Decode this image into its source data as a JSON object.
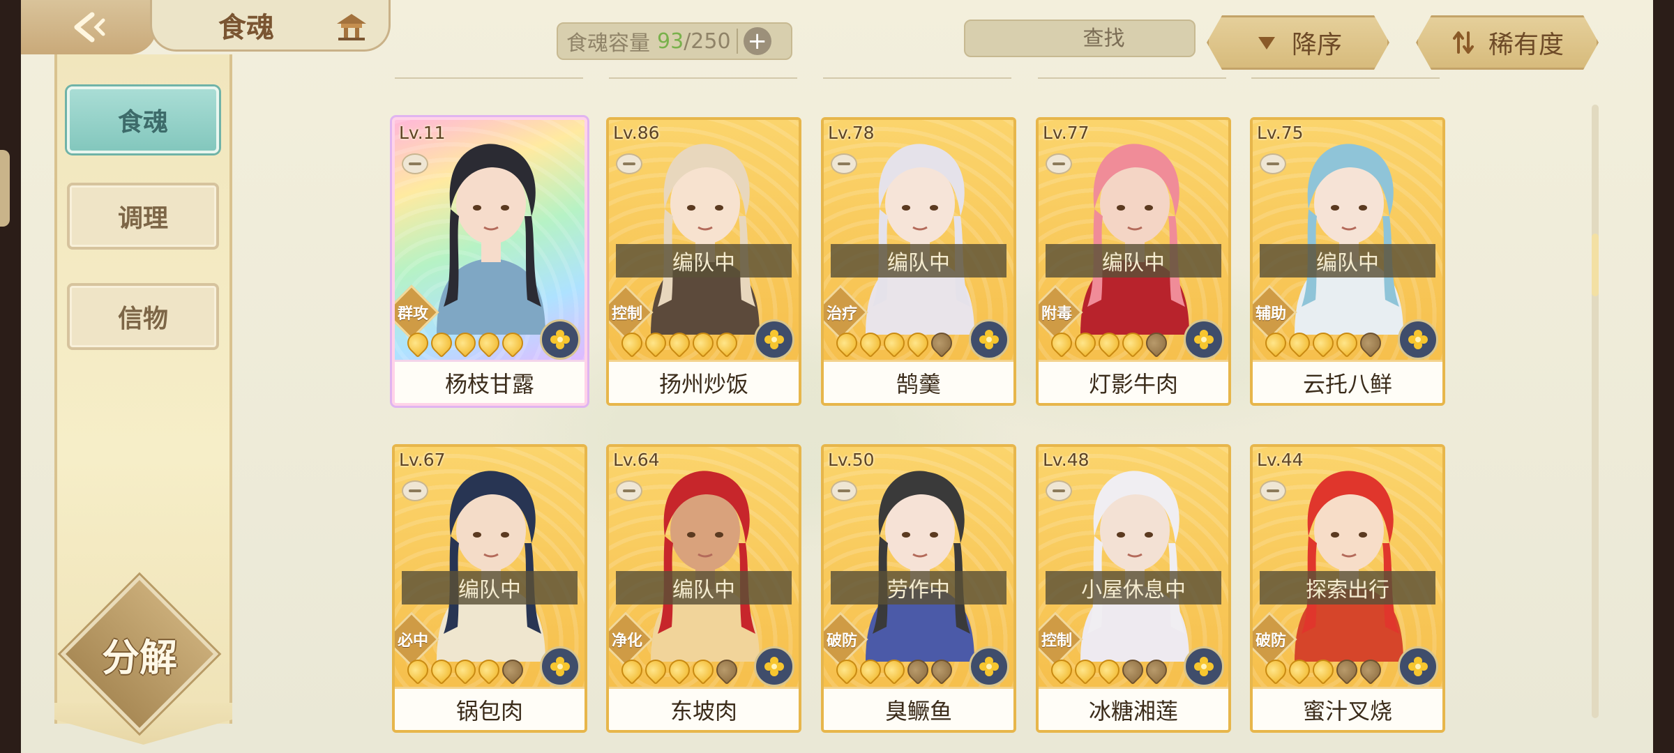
{
  "header": {
    "title": "食魂",
    "capacity_label": "食魂容量",
    "capacity_current": "93",
    "capacity_total": "/250",
    "search_placeholder": "查找",
    "sort_order_label": "降序",
    "sort_by_label": "稀有度"
  },
  "sidebar": {
    "items": [
      {
        "label": "食魂",
        "active": true
      },
      {
        "label": "调理",
        "active": false
      },
      {
        "label": "信物",
        "active": false
      }
    ],
    "decompose_label": "分解"
  },
  "cards": [
    {
      "level": "Lv.11",
      "name": "杨枝甘露",
      "status": "",
      "role": "群攻",
      "stars_filled": 5,
      "rarity": "rainbow",
      "hair": "#2b2b33",
      "skin": "#f6dccb",
      "outfit": "#7fa7c4"
    },
    {
      "level": "Lv.86",
      "name": "扬州炒饭",
      "status": "编队中",
      "role": "控制",
      "stars_filled": 5,
      "rarity": "gold",
      "hair": "#e8d7bd",
      "skin": "#f7e2cf",
      "outfit": "#5c4a3b"
    },
    {
      "level": "Lv.78",
      "name": "鹄羹",
      "status": "编队中",
      "role": "治疗",
      "stars_filled": 4,
      "rarity": "gold",
      "hair": "#e5e2ea",
      "skin": "#f6e4d8",
      "outfit": "#e9e4ea"
    },
    {
      "level": "Lv.77",
      "name": "灯影牛肉",
      "status": "编队中",
      "role": "附毒",
      "stars_filled": 4,
      "rarity": "gold",
      "hair": "#f08c98",
      "skin": "#f4d5c5",
      "outfit": "#b8232c"
    },
    {
      "level": "Lv.75",
      "name": "云托八鲜",
      "status": "编队中",
      "role": "辅助",
      "stars_filled": 4,
      "rarity": "gold",
      "hair": "#8fc4d8",
      "skin": "#f6e3d6",
      "outfit": "#e8eef2"
    },
    {
      "level": "Lv.67",
      "name": "锅包肉",
      "status": "编队中",
      "role": "必中",
      "stars_filled": 4,
      "rarity": "gold",
      "hair": "#283553",
      "skin": "#f4dcc8",
      "outfit": "#efe6cf"
    },
    {
      "level": "Lv.64",
      "name": "东坡肉",
      "status": "编队中",
      "role": "净化",
      "stars_filled": 4,
      "rarity": "gold",
      "hair": "#c7262b",
      "skin": "#d9a27c",
      "outfit": "#f1d49a"
    },
    {
      "level": "Lv.50",
      "name": "臭鳜鱼",
      "status": "劳作中",
      "role": "破防",
      "stars_filled": 3,
      "rarity": "gold",
      "hair": "#3a3a3a",
      "skin": "#f6e2d6",
      "outfit": "#4b5aa8"
    },
    {
      "level": "Lv.48",
      "name": "冰糖湘莲",
      "status": "小屋休息中",
      "role": "控制",
      "stars_filled": 3,
      "rarity": "gold",
      "hair": "#f0eef2",
      "skin": "#f3e1d4",
      "outfit": "#eeeaf0"
    },
    {
      "level": "Lv.44",
      "name": "蜜汁叉烧",
      "status": "探索出行",
      "role": "破防",
      "stars_filled": 3,
      "rarity": "gold",
      "hair": "#e0362c",
      "skin": "#f7ddc8",
      "outfit": "#d6452a"
    }
  ],
  "colors": {
    "accent_teal": "#83c7bd",
    "card_border_gold": "#e7b64b",
    "capacity_green": "#79b14c"
  }
}
